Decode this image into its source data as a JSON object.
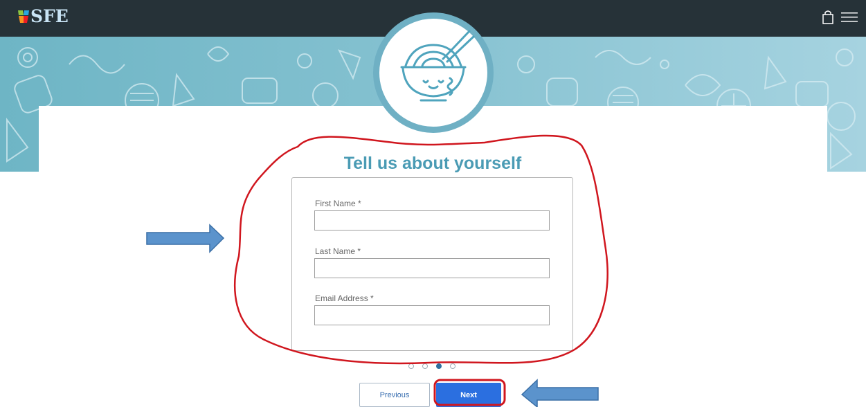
{
  "brand": {
    "logo_text": "SFE"
  },
  "header": {
    "cart_icon": "shopping-bag-icon",
    "menu_icon": "hamburger-menu-icon"
  },
  "hero": {
    "badge_icon": "noodle-bowl-icon"
  },
  "form": {
    "title": "Tell us about yourself",
    "fields": [
      {
        "label": "First Name *",
        "value": "",
        "placeholder": ""
      },
      {
        "label": "Last Name *",
        "value": "",
        "placeholder": ""
      },
      {
        "label": "Email Address *",
        "value": "",
        "placeholder": ""
      }
    ]
  },
  "progress": {
    "total_steps": 4,
    "current_step": 3
  },
  "buttons": {
    "previous_label": "Previous",
    "next_label": "Next"
  },
  "colors": {
    "header_bg": "#263238",
    "hero_bg": "#86c2d1",
    "accent_title": "#4a9bb4",
    "next_button": "#2b6fe0",
    "annotation_red": "#d0161e",
    "annotation_arrow": "#5b93cc"
  }
}
